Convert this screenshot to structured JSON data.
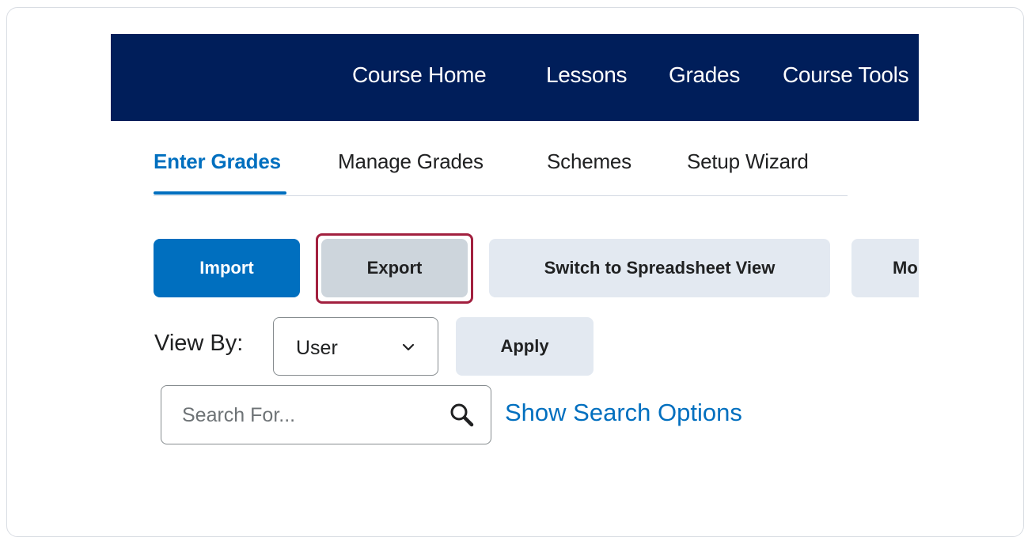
{
  "navbar": {
    "items": [
      "Course Home",
      "Lessons",
      "Grades",
      "Course Tools"
    ]
  },
  "tabs": [
    {
      "label": "Enter Grades",
      "active": true
    },
    {
      "label": "Manage Grades",
      "active": false
    },
    {
      "label": "Schemes",
      "active": false
    },
    {
      "label": "Setup Wizard",
      "active": false
    }
  ],
  "toolbar": {
    "import_label": "Import",
    "export_label": "Export",
    "spreadsheet_label": "Switch to Spreadsheet View",
    "more_label": "More Actions"
  },
  "view_by": {
    "label": "View By:",
    "selected": "User",
    "apply_label": "Apply"
  },
  "search": {
    "placeholder": "Search For...",
    "value": "",
    "options_link": "Show Search Options"
  },
  "colors": {
    "navbar_bg": "#001e5a",
    "accent": "#006fbf",
    "highlight": "#a2203f",
    "button_bg": "#e3e9f1"
  }
}
